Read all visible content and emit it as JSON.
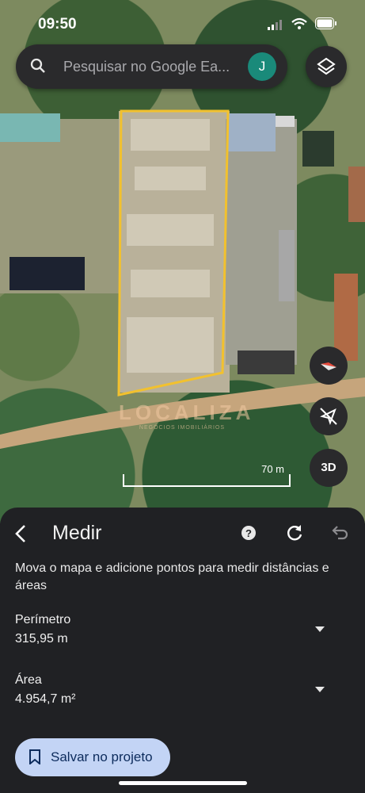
{
  "status_bar": {
    "time": "09:50"
  },
  "search": {
    "placeholder": "Pesquisar no Google Ea...",
    "avatar_initial": "J"
  },
  "map": {
    "scale_label": "70 m",
    "button_3d": "3D",
    "watermark_brand": "LOCALIZA",
    "watermark_tagline": "NEGÓCIOS IMOBILIÁRIOS",
    "polygon_color": "#f2c12e"
  },
  "measure": {
    "title": "Medir",
    "description": "Mova o mapa e adicione pontos para medir distâncias e áreas",
    "perimeter_label": "Perímetro",
    "perimeter_value": "315,95 m",
    "area_label": "Área",
    "area_value": "4.954,7 m²",
    "save_button": "Salvar no projeto"
  },
  "accent_color": "#c3d4f5"
}
